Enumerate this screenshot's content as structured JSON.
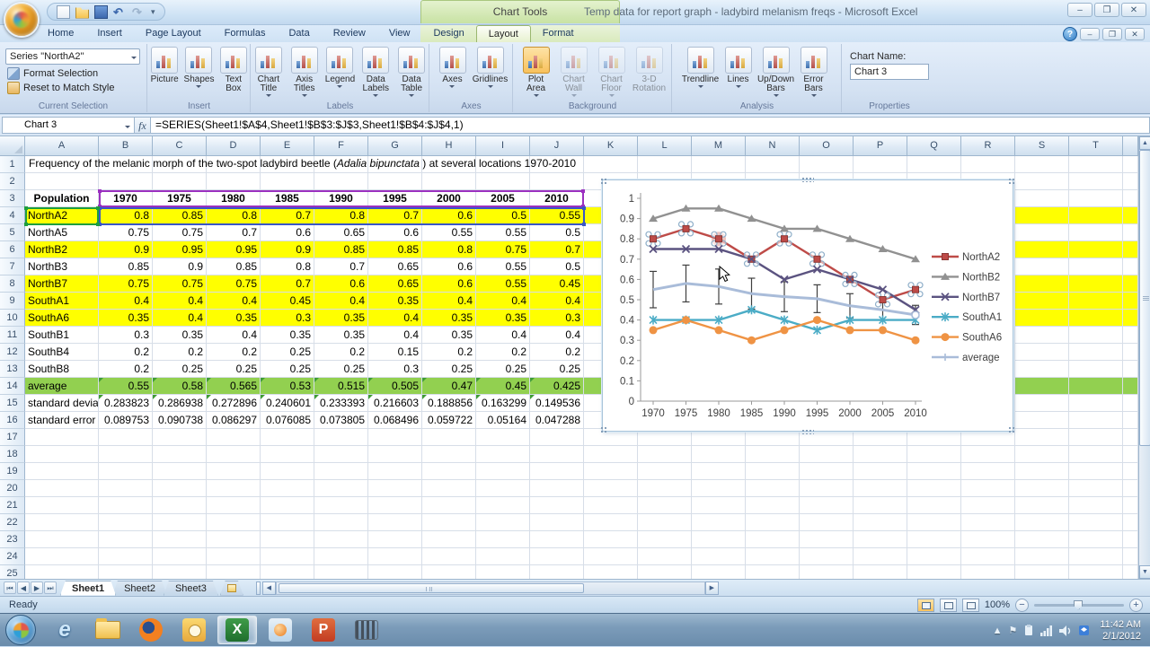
{
  "window": {
    "title": "Temp data for report graph - ladybird melanism freqs - Microsoft Excel",
    "chart_tools_label": "Chart Tools"
  },
  "ribbon": {
    "tabs": [
      "Home",
      "Insert",
      "Page Layout",
      "Formulas",
      "Data",
      "Review",
      "View",
      "Design",
      "Layout",
      "Format"
    ],
    "active_tab": "Layout",
    "contextual_tabs": [
      "Design",
      "Layout",
      "Format"
    ],
    "groups": {
      "current_selection": {
        "label": "Current Selection",
        "dropdown_value": "Series \"NorthA2\"",
        "buttons": [
          "Format Selection",
          "Reset to Match Style"
        ]
      },
      "insert": {
        "label": "Insert",
        "buttons": [
          {
            "text": "Picture"
          },
          {
            "text": "Shapes",
            "arrow": true
          },
          {
            "text": "Text Box"
          }
        ]
      },
      "labels": {
        "label": "Labels",
        "buttons": [
          {
            "text": "Chart Title",
            "arrow": true
          },
          {
            "text": "Axis Titles",
            "arrow": true
          },
          {
            "text": "Legend",
            "arrow": true
          },
          {
            "text": "Data Labels",
            "arrow": true
          },
          {
            "text": "Data Table",
            "arrow": true
          }
        ]
      },
      "axes": {
        "label": "Axes",
        "buttons": [
          {
            "text": "Axes",
            "arrow": true
          },
          {
            "text": "Gridlines",
            "arrow": true
          }
        ]
      },
      "background": {
        "label": "Background",
        "buttons": [
          {
            "text": "Plot Area",
            "arrow": true,
            "active": true
          },
          {
            "text": "Chart Wall",
            "arrow": true,
            "disabled": true
          },
          {
            "text": "Chart Floor",
            "arrow": true,
            "disabled": true
          },
          {
            "text": "3-D Rotation",
            "disabled": true
          }
        ]
      },
      "analysis": {
        "label": "Analysis",
        "buttons": [
          {
            "text": "Trendline",
            "arrow": true
          },
          {
            "text": "Lines",
            "arrow": true
          },
          {
            "text": "Up/Down Bars",
            "arrow": true
          },
          {
            "text": "Error Bars",
            "arrow": true
          }
        ]
      },
      "properties": {
        "label": "Properties",
        "chart_name_label": "Chart Name:",
        "chart_name_value": "Chart 3"
      }
    }
  },
  "formula_bar": {
    "name_box": "Chart 3",
    "formula": "=SERIES(Sheet1!$A$4,Sheet1!$B$3:$J$3,Sheet1!$B$4:$J$4,1)"
  },
  "spreadsheet": {
    "columns": [
      "A",
      "B",
      "C",
      "D",
      "E",
      "F",
      "G",
      "H",
      "I",
      "J",
      "K",
      "L",
      "M",
      "N",
      "O",
      "P",
      "Q",
      "R",
      "S",
      "T"
    ],
    "visible_rows": 25,
    "title_row": {
      "pre": "Frequency of the melanic morph of the two-spot ladybird beetle (",
      "italic": "Adalia bipunctata",
      "post": " ) at several locations 1970-2010"
    },
    "header_row": {
      "row": 3,
      "label": "Population",
      "years": [
        "1970",
        "1975",
        "1980",
        "1985",
        "1990",
        "1995",
        "2000",
        "2005",
        "2010"
      ]
    },
    "rows": [
      {
        "n": 4,
        "label": "NorthA2",
        "bg": "yellow",
        "values": [
          "0.8",
          "0.85",
          "0.8",
          "0.7",
          "0.8",
          "0.7",
          "0.6",
          "0.5",
          "0.55"
        ]
      },
      {
        "n": 5,
        "label": "NorthA5",
        "values": [
          "0.75",
          "0.75",
          "0.7",
          "0.6",
          "0.65",
          "0.6",
          "0.55",
          "0.55",
          "0.5"
        ]
      },
      {
        "n": 6,
        "label": "NorthB2",
        "bg": "yellow",
        "values": [
          "0.9",
          "0.95",
          "0.95",
          "0.9",
          "0.85",
          "0.85",
          "0.8",
          "0.75",
          "0.7"
        ]
      },
      {
        "n": 7,
        "label": "NorthB3",
        "values": [
          "0.85",
          "0.9",
          "0.85",
          "0.8",
          "0.7",
          "0.65",
          "0.6",
          "0.55",
          "0.5"
        ]
      },
      {
        "n": 8,
        "label": "NorthB7",
        "bg": "yellow",
        "values": [
          "0.75",
          "0.75",
          "0.75",
          "0.7",
          "0.6",
          "0.65",
          "0.6",
          "0.55",
          "0.45"
        ]
      },
      {
        "n": 9,
        "label": "SouthA1",
        "bg": "yellow",
        "values": [
          "0.4",
          "0.4",
          "0.4",
          "0.45",
          "0.4",
          "0.35",
          "0.4",
          "0.4",
          "0.4"
        ]
      },
      {
        "n": 10,
        "label": "SouthA6",
        "bg": "yellow",
        "values": [
          "0.35",
          "0.4",
          "0.35",
          "0.3",
          "0.35",
          "0.4",
          "0.35",
          "0.35",
          "0.3"
        ]
      },
      {
        "n": 11,
        "label": "SouthB1",
        "values": [
          "0.3",
          "0.35",
          "0.4",
          "0.35",
          "0.35",
          "0.4",
          "0.35",
          "0.4",
          "0.4"
        ]
      },
      {
        "n": 12,
        "label": "SouthB4",
        "values": [
          "0.2",
          "0.2",
          "0.2",
          "0.25",
          "0.2",
          "0.15",
          "0.2",
          "0.2",
          "0.2"
        ]
      },
      {
        "n": 13,
        "label": "SouthB8",
        "values": [
          "0.2",
          "0.25",
          "0.25",
          "0.25",
          "0.25",
          "0.3",
          "0.25",
          "0.25",
          "0.25"
        ]
      },
      {
        "n": 14,
        "label": "average",
        "bg": "green",
        "flags": true,
        "values": [
          "0.55",
          "0.58",
          "0.565",
          "0.53",
          "0.515",
          "0.505",
          "0.47",
          "0.45",
          "0.425"
        ]
      },
      {
        "n": 15,
        "label": "standard devia",
        "flags": true,
        "values": [
          "0.283823",
          "0.286938",
          "0.272896",
          "0.240601",
          "0.233393",
          "0.216603",
          "0.188856",
          "0.163299",
          "0.149536"
        ]
      },
      {
        "n": 16,
        "label": "standard error",
        "values": [
          "0.089753",
          "0.090738",
          "0.086297",
          "0.076085",
          "0.073805",
          "0.068496",
          "0.059722",
          "0.05164",
          "0.047288"
        ]
      }
    ],
    "highlight_colors": {
      "yellow": "#FFFF00",
      "green": "#92D050"
    }
  },
  "chart_data": {
    "type": "line",
    "x": [
      "1970",
      "1975",
      "1980",
      "1985",
      "1990",
      "1995",
      "2000",
      "2005",
      "2010"
    ],
    "ylim": [
      0,
      1
    ],
    "ytick": 0.1,
    "grid": false,
    "legend_position": "right",
    "series": [
      {
        "name": "NorthA2",
        "color": "#BE4B48",
        "marker": "square",
        "selected": true,
        "values": [
          0.8,
          0.85,
          0.8,
          0.7,
          0.8,
          0.7,
          0.6,
          0.5,
          0.55
        ]
      },
      {
        "name": "NorthB2",
        "color": "#919191",
        "marker": "triangle",
        "values": [
          0.9,
          0.95,
          0.95,
          0.9,
          0.85,
          0.85,
          0.8,
          0.75,
          0.7
        ]
      },
      {
        "name": "NorthB7",
        "color": "#5B5380",
        "marker": "x",
        "values": [
          0.75,
          0.75,
          0.75,
          0.7,
          0.6,
          0.65,
          0.6,
          0.55,
          0.45
        ]
      },
      {
        "name": "SouthA1",
        "color": "#4BACC6",
        "marker": "asterisk",
        "values": [
          0.4,
          0.4,
          0.4,
          0.45,
          0.4,
          0.35,
          0.4,
          0.4,
          0.4
        ]
      },
      {
        "name": "SouthA6",
        "color": "#EF9344",
        "marker": "circle",
        "values": [
          0.35,
          0.4,
          0.35,
          0.3,
          0.35,
          0.4,
          0.35,
          0.35,
          0.3
        ]
      },
      {
        "name": "average",
        "color": "#A9BCD9",
        "marker": "none",
        "values": [
          0.55,
          0.58,
          0.565,
          0.53,
          0.515,
          0.505,
          0.47,
          0.45,
          0.425
        ],
        "error_bars": [
          0.089753,
          0.090738,
          0.086297,
          0.076085,
          0.073805,
          0.068496,
          0.059722,
          0.05164,
          0.047288
        ]
      }
    ]
  },
  "sheet_tabs": {
    "tabs": [
      "Sheet1",
      "Sheet2",
      "Sheet3"
    ],
    "active": "Sheet1"
  },
  "status_bar": {
    "ready": "Ready",
    "zoom": "100%"
  },
  "taskbar": {
    "items": [
      {
        "name": "internet-explorer-icon"
      },
      {
        "name": "windows-explorer-icon"
      },
      {
        "name": "firefox-icon"
      },
      {
        "name": "outlook-icon"
      },
      {
        "name": "excel-icon",
        "active": true
      },
      {
        "name": "media-player-icon"
      },
      {
        "name": "powerpoint-icon"
      },
      {
        "name": "movie-maker-icon"
      }
    ],
    "tray": {
      "time": "11:42 AM",
      "date": "2/1/2012"
    }
  }
}
